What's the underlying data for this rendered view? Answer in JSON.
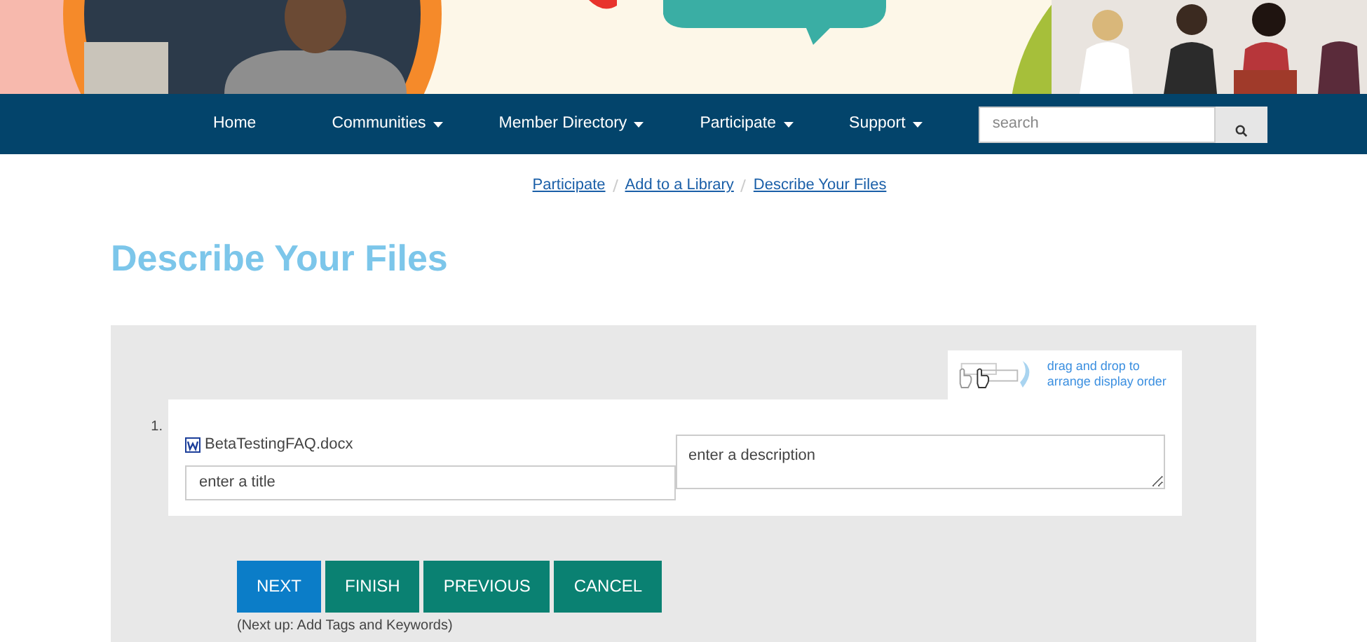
{
  "banner": {
    "kind": "picture"
  },
  "nav": {
    "items": [
      {
        "label": "Home",
        "dropdown": false
      },
      {
        "label": "Communities",
        "dropdown": true
      },
      {
        "label": "Member Directory",
        "dropdown": true
      },
      {
        "label": "Participate",
        "dropdown": true
      },
      {
        "label": "Support",
        "dropdown": true
      }
    ],
    "search": {
      "placeholder": "search"
    }
  },
  "breadcrumb": [
    "Participate",
    "Add to a Library",
    "Describe Your Files"
  ],
  "page_title": "Describe Your Files",
  "drag_hint": "drag and drop to arrange display order",
  "files": [
    {
      "number": "1.",
      "filename": "BetaTestingFAQ.docx",
      "title_placeholder": "enter a title",
      "description_placeholder": "enter a description"
    }
  ],
  "buttons": [
    {
      "label": "NEXT",
      "kind": "primary"
    },
    {
      "label": "FINISH",
      "kind": "secondary"
    },
    {
      "label": "PREVIOUS",
      "kind": "secondary"
    },
    {
      "label": "CANCEL",
      "kind": "secondary"
    }
  ],
  "next_note": "(Next up: Add Tags and Keywords)"
}
